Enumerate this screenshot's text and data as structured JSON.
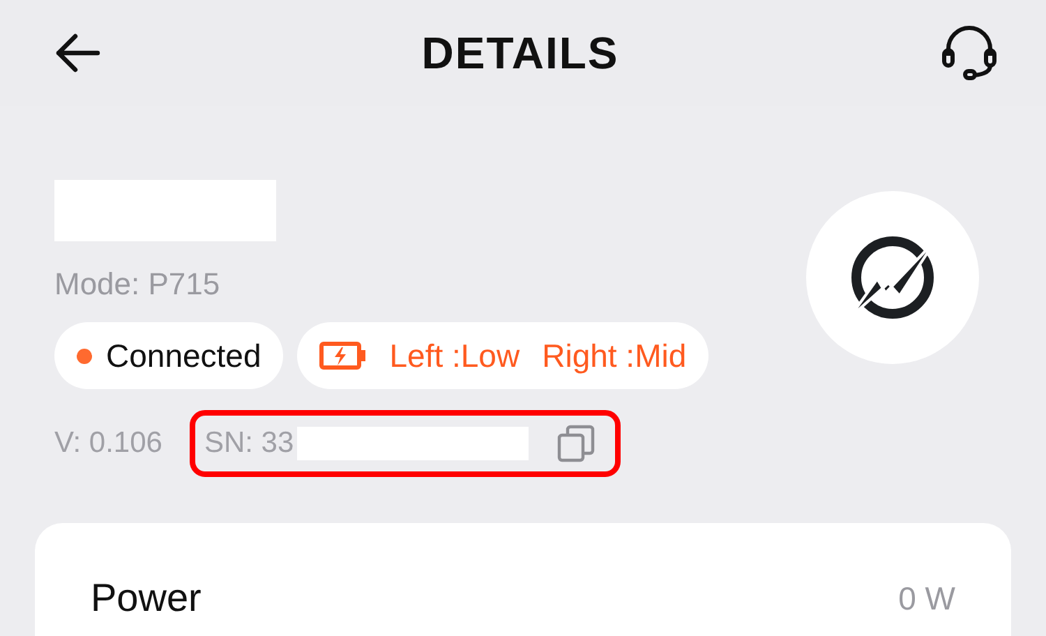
{
  "header": {
    "title": "DETAILS"
  },
  "device": {
    "model": "Mode: P715",
    "status": {
      "label": "Connected",
      "color": "#ff6a2f"
    },
    "battery": {
      "left": "Left :Low",
      "right": "Right :Mid"
    },
    "version": "V: 0.106",
    "serial": "SN: 33"
  },
  "card": {
    "rows": [
      {
        "label": "Power",
        "value": "0 W"
      }
    ]
  }
}
